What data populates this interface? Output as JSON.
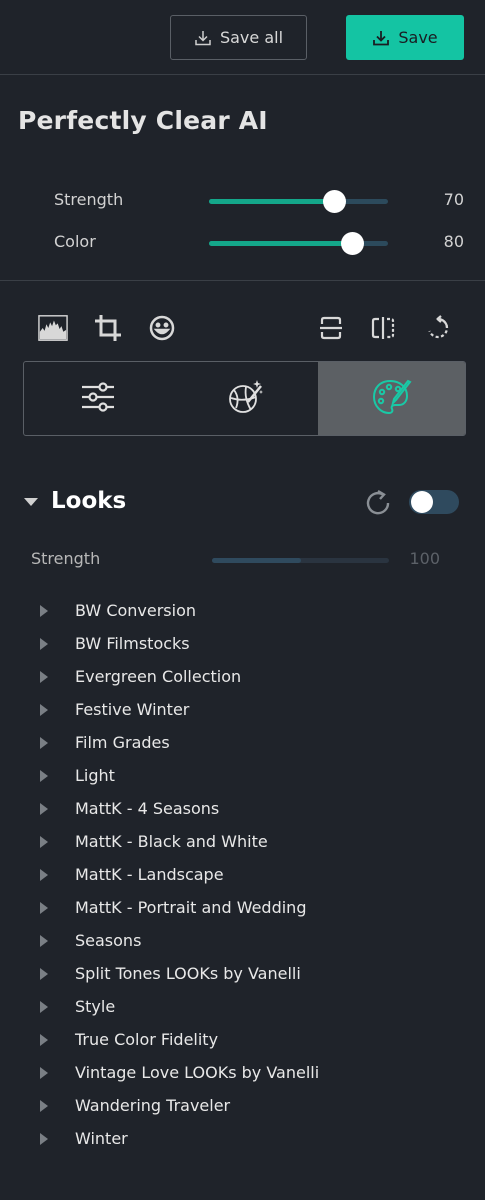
{
  "topbar": {
    "save_all_label": "Save all",
    "save_label": "Save"
  },
  "perfectly_clear": {
    "title": "Perfectly Clear AI",
    "sliders": [
      {
        "label": "Strength",
        "value": "70",
        "percent": 70
      },
      {
        "label": "Color",
        "value": "80",
        "percent": 80
      }
    ]
  },
  "tools": {
    "icons": [
      "histogram-icon",
      "crop-icon",
      "face-icon",
      "flip-vertical-icon",
      "flip-horizontal-icon",
      "rotate-icon"
    ]
  },
  "tabs": {
    "items": [
      "adjustments-tab",
      "ai-magic-tab",
      "looks-palette-tab"
    ],
    "active_index": 2
  },
  "looks": {
    "title": "Looks",
    "enabled": true,
    "strength_label": "Strength",
    "strength_value": "100",
    "items": [
      "BW Conversion",
      "BW Filmstocks",
      "Evergreen Collection",
      "Festive Winter",
      "Film Grades",
      "Light",
      "MattK - 4 Seasons",
      "MattK - Black and White",
      "MattK - Landscape",
      "MattK - Portrait and Wedding",
      "Seasons",
      "Split Tones LOOKs by Vanelli",
      "Style",
      "True Color Fidelity",
      "Vintage Love LOOKs by Vanelli",
      "Wandering Traveler",
      "Winter"
    ]
  },
  "colors": {
    "background": "#1f232a",
    "accent": "#14c4a3",
    "slider_fill": "#14a78a",
    "slider_track": "#2c4a5c",
    "active_tab": "#5c6064"
  }
}
